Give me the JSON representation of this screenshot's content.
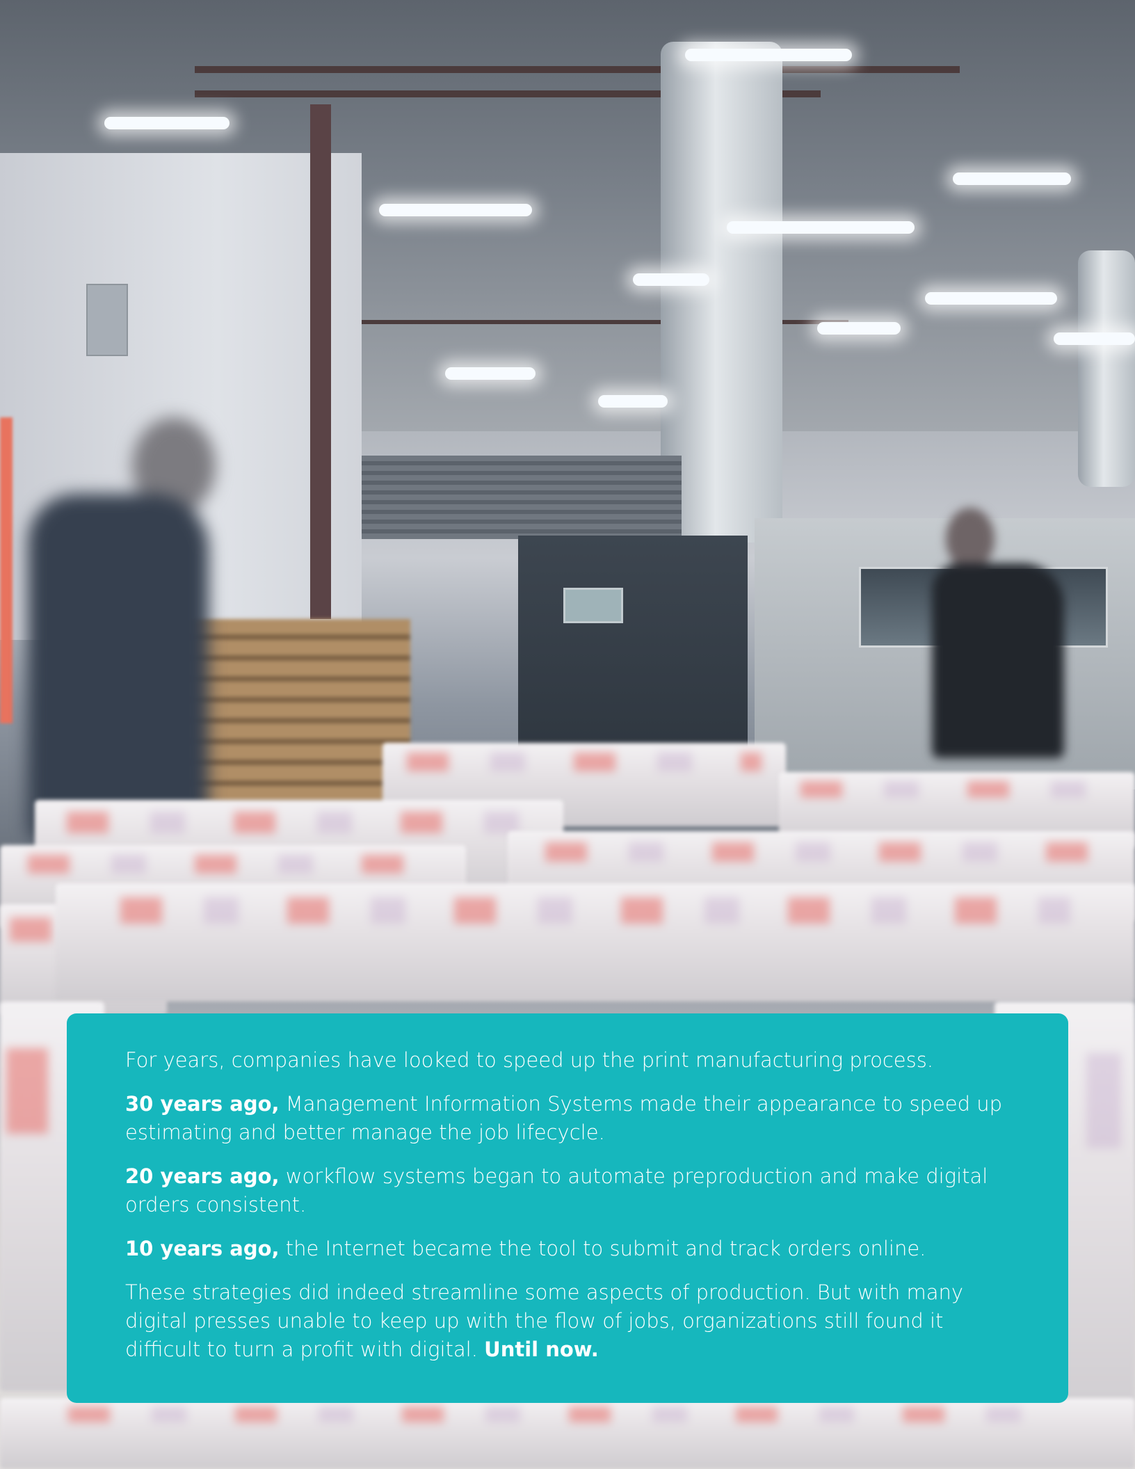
{
  "photo": {
    "alt_description_name": "print-production-floor-photo"
  },
  "intro": {
    "paragraph_1": "For years, companies have looked to speed up the print manufacturing process.",
    "p2_lead": "30 years ago,",
    "p2_rest": " Management Information Systems made their appearance to speed up estimating and better manage the job lifecycle.",
    "p3_lead": "20 years ago,",
    "p3_rest": " workflow systems began to automate preproduction and make digital orders consistent.",
    "p4_lead": "10 years ago,",
    "p4_rest": " the Internet became the tool to submit and track orders online.",
    "p5_text": "These strategies did indeed streamline some aspects of production. But with many digital presses unable to keep up with the flow of jobs, organizations still found it difficult to turn a profit with digital. ",
    "p5_emphasis": "Until now."
  },
  "colors": {
    "panel_teal": "#16b7bd",
    "text_white": "#ffffff"
  }
}
